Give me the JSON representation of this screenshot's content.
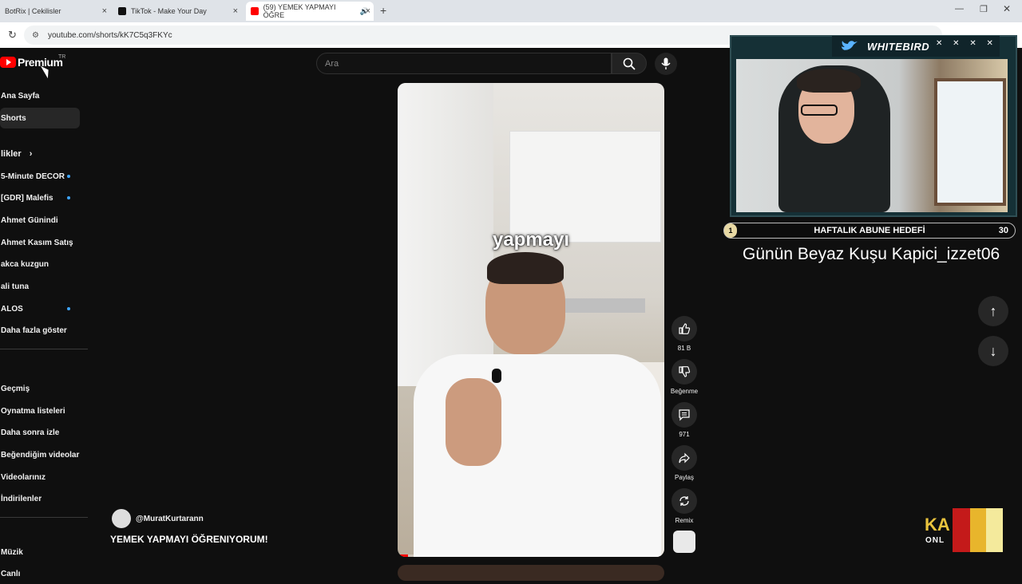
{
  "browser": {
    "tabs": [
      {
        "label": "BotRix | Cekilisler",
        "active": false
      },
      {
        "label": "TikTok - Make Your Day",
        "active": false
      },
      {
        "label": "(59) YEMEK YAPMAYI ÖĞRE",
        "active": true
      }
    ],
    "url": "youtube.com/shorts/kK7C5q3FKYc",
    "new_tab": "+",
    "close": "×"
  },
  "sidebar": {
    "logo": "Premium",
    "logo_region": "TR",
    "items": [
      {
        "label": "Ana Sayfa"
      },
      {
        "label": "Shorts"
      }
    ],
    "subscriptions_header": "likler",
    "subscriptions": [
      {
        "label": "5-Minute DECOR",
        "dot": true
      },
      {
        "label": "[GDR] Malefis",
        "dot": true
      },
      {
        "label": "Ahmet Günindi",
        "dot": false
      },
      {
        "label": "Ahmet Kasım Satış",
        "dot": false
      },
      {
        "label": "akca kuzgun",
        "dot": false
      },
      {
        "label": "ali tuna",
        "dot": false
      },
      {
        "label": "ALOS",
        "dot": true
      },
      {
        "label": "Daha fazla göster",
        "dot": false
      }
    ],
    "you_items": [
      {
        "label": "Geçmiş"
      },
      {
        "label": "Oynatma listeleri"
      },
      {
        "label": "Daha sonra izle"
      },
      {
        "label": "Beğendiğim videolar"
      },
      {
        "label": "Videolarınız"
      },
      {
        "label": "İndirilenler"
      }
    ],
    "explore_items": [
      {
        "label": "Müzik"
      },
      {
        "label": "Canlı"
      }
    ]
  },
  "search": {
    "placeholder": "Ara"
  },
  "short": {
    "caption": "yapmayı",
    "channel": "@MuratKurtarann",
    "title": "YEMEK YAPMAYI ÖĞRENIYORUM!",
    "progress": 0.04,
    "actions": {
      "like_count": "81 B",
      "dislike_label": "Beğenme",
      "comment_count": "971",
      "share_label": "Paylaş",
      "remix_label": "Remix"
    }
  },
  "overlay": {
    "cam_title": "WHITEBIRD",
    "cam_buttons": "✕ ✕ ✕ ✕",
    "goal_label": "HAFTALIK ABUNE HEDEFİ",
    "goal_current": "1",
    "goal_target": "30",
    "daily_bird": "Günün Beyaz Kuşu Kapici_izzet06",
    "brand_ka": "KA",
    "brand_onl": "ONL"
  },
  "colors": {
    "accent": "#ff0000",
    "background": "#0f0f0f",
    "dot": "#3ea6ff"
  }
}
